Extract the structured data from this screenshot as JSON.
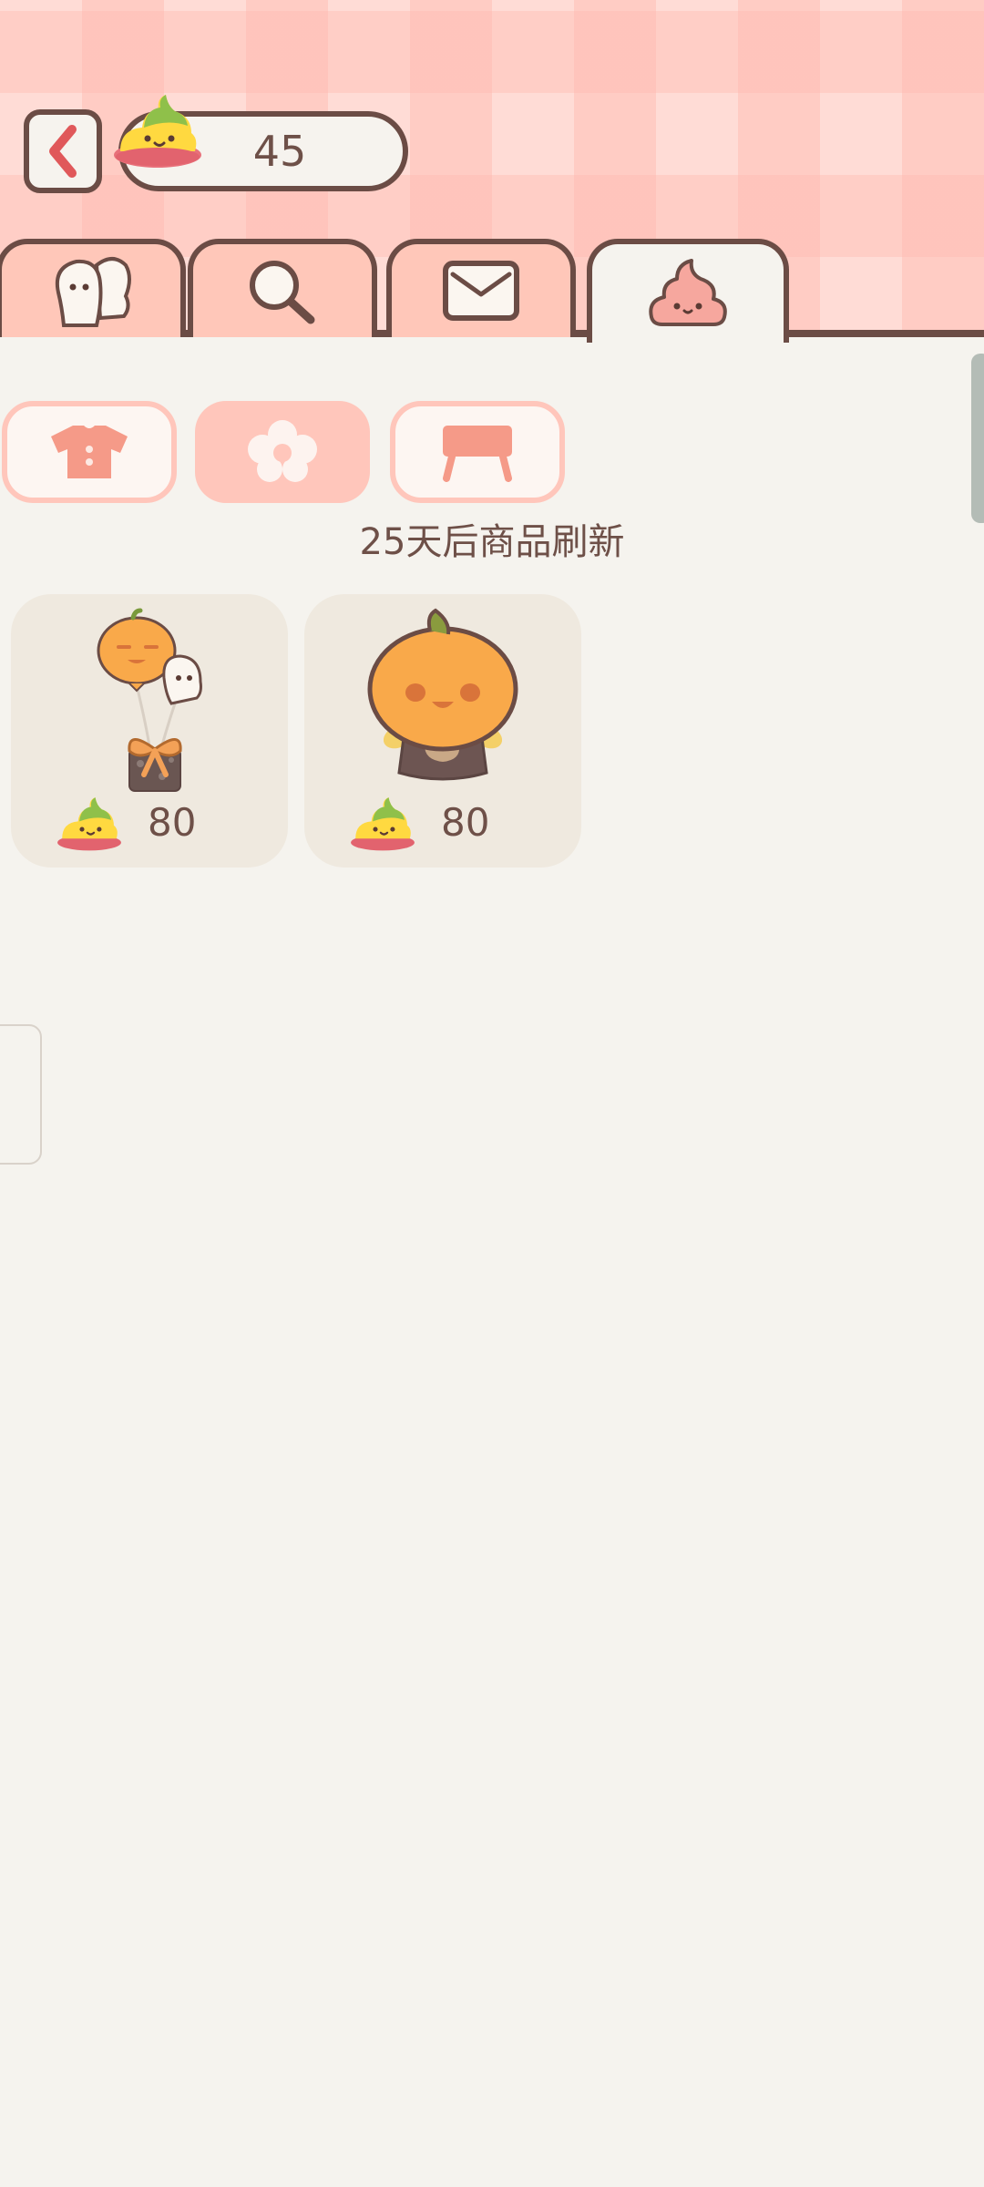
{
  "header": {
    "currency_amount": "45",
    "back_label": ""
  },
  "tabs": [
    {
      "name": "friends",
      "icon": "ghost-friends-icon",
      "active": false
    },
    {
      "name": "search",
      "icon": "magnifier-icon",
      "active": false
    },
    {
      "name": "mail",
      "icon": "envelope-icon",
      "active": false
    },
    {
      "name": "shop",
      "icon": "poop-icon",
      "active": true
    }
  ],
  "categories": [
    {
      "name": "clothes",
      "icon": "shirt-icon",
      "selected": false
    },
    {
      "name": "decor",
      "icon": "flower-icon",
      "selected": true
    },
    {
      "name": "furniture",
      "icon": "table-icon",
      "selected": false
    }
  ],
  "refresh_text": "25天后商品刷新",
  "items": [
    {
      "name": "pumpkin-balloon-gift",
      "price": "80"
    },
    {
      "name": "pumpkin-head-costume",
      "price": "80"
    }
  ],
  "colors": {
    "outline": "#6b4c45",
    "tab_bg": "#ffc7b9",
    "content_bg": "#f5f3ee",
    "card_bg": "#efe9df",
    "accent_pink": "#ffc6bb"
  }
}
